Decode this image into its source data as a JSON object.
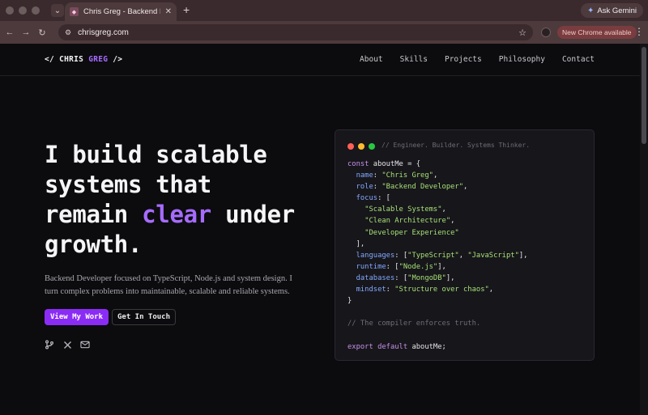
{
  "browser": {
    "tab_title": "Chris Greg - Backend Develop",
    "tab_favicon": "cg-favicon",
    "url": "chrisgreg.com",
    "ask_gemini": "Ask Gemini",
    "new_chrome": "New Chrome available"
  },
  "site": {
    "logo_prefix": "</ ",
    "logo_first": "CHRIS ",
    "logo_accent": "GREG",
    "logo_suffix": " />",
    "nav": [
      "About",
      "Skills",
      "Projects",
      "Philosophy",
      "Contact"
    ]
  },
  "hero": {
    "title_l1": "I build scalable",
    "title_l2": "systems that",
    "title_l3a": "remain ",
    "title_l3b": "clear",
    "title_l3c": " under",
    "title_l4": "growth.",
    "desc": "Backend Developer focused on TypeScript, Node.js and system design. I turn complex problems into maintainable, scalable and reliable systems.",
    "btn_primary": "View My Work",
    "btn_secondary": "Get In Touch"
  },
  "code_card": {
    "comment": "// Engineer. Builder. Systems Thinker.",
    "lines": [
      [
        [
          "k",
          "const "
        ],
        [
          "d",
          "aboutMe"
        ],
        [
          "d",
          " = {"
        ]
      ],
      [
        [
          "d",
          "  "
        ],
        [
          "p",
          "name"
        ],
        [
          "d",
          ": "
        ],
        [
          "s",
          "\"Chris Greg\""
        ],
        [
          "d",
          ","
        ]
      ],
      [
        [
          "d",
          "  "
        ],
        [
          "p",
          "role"
        ],
        [
          "d",
          ": "
        ],
        [
          "s",
          "\"Backend Developer\""
        ],
        [
          "d",
          ","
        ]
      ],
      [
        [
          "d",
          "  "
        ],
        [
          "p",
          "focus"
        ],
        [
          "d",
          ": ["
        ]
      ],
      [
        [
          "d",
          "    "
        ],
        [
          "s",
          "\"Scalable Systems\""
        ],
        [
          "d",
          ","
        ]
      ],
      [
        [
          "d",
          "    "
        ],
        [
          "s",
          "\"Clean Architecture\""
        ],
        [
          "d",
          ","
        ]
      ],
      [
        [
          "d",
          "    "
        ],
        [
          "s",
          "\"Developer Experience\""
        ]
      ],
      [
        [
          "d",
          "  ],"
        ]
      ],
      [
        [
          "d",
          "  "
        ],
        [
          "p",
          "languages"
        ],
        [
          "d",
          ": ["
        ],
        [
          "s",
          "\"TypeScript\""
        ],
        [
          "d",
          ", "
        ],
        [
          "s",
          "\"JavaScript\""
        ],
        [
          "d",
          "],"
        ]
      ],
      [
        [
          "d",
          "  "
        ],
        [
          "p",
          "runtime"
        ],
        [
          "d",
          ": ["
        ],
        [
          "s",
          "\"Node.js\""
        ],
        [
          "d",
          "],"
        ]
      ],
      [
        [
          "d",
          "  "
        ],
        [
          "p",
          "databases"
        ],
        [
          "d",
          ": ["
        ],
        [
          "s",
          "\"MongoDB\""
        ],
        [
          "d",
          "],"
        ]
      ],
      [
        [
          "d",
          "  "
        ],
        [
          "p",
          "mindset"
        ],
        [
          "d",
          ": "
        ],
        [
          "s",
          "\"Structure over chaos\""
        ],
        [
          "d",
          ","
        ]
      ],
      [
        [
          "d",
          "}"
        ]
      ],
      [
        [
          "d",
          ""
        ]
      ],
      [
        [
          "c",
          "// The compiler enforces truth."
        ]
      ],
      [
        [
          "d",
          ""
        ]
      ],
      [
        [
          "k",
          "export default "
        ],
        [
          "d",
          "aboutMe;"
        ]
      ]
    ]
  },
  "colors": {
    "accent": "#a66cff",
    "primary_button": "#8b2cf5",
    "dot_red": "#ff5f57",
    "dot_yellow": "#febc2e",
    "dot_green": "#28c840"
  }
}
